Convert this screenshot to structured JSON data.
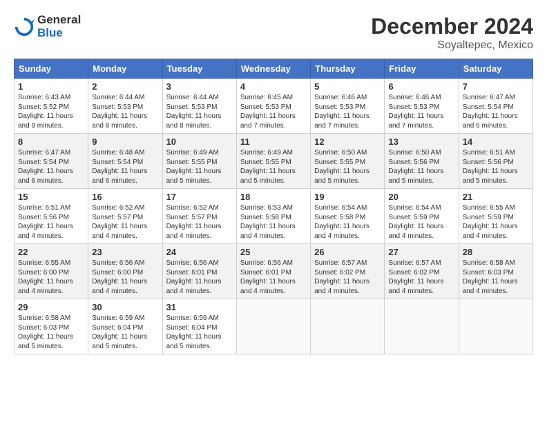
{
  "logo": {
    "general": "General",
    "blue": "Blue"
  },
  "title": {
    "month": "December 2024",
    "location": "Soyaltepec, Mexico"
  },
  "headers": [
    "Sunday",
    "Monday",
    "Tuesday",
    "Wednesday",
    "Thursday",
    "Friday",
    "Saturday"
  ],
  "weeks": [
    [
      {
        "day": "1",
        "sunrise": "6:43 AM",
        "sunset": "5:52 PM",
        "daylight": "11 hours and 9 minutes."
      },
      {
        "day": "2",
        "sunrise": "6:44 AM",
        "sunset": "5:53 PM",
        "daylight": "11 hours and 8 minutes."
      },
      {
        "day": "3",
        "sunrise": "6:44 AM",
        "sunset": "5:53 PM",
        "daylight": "11 hours and 8 minutes."
      },
      {
        "day": "4",
        "sunrise": "6:45 AM",
        "sunset": "5:53 PM",
        "daylight": "11 hours and 7 minutes."
      },
      {
        "day": "5",
        "sunrise": "6:46 AM",
        "sunset": "5:53 PM",
        "daylight": "11 hours and 7 minutes."
      },
      {
        "day": "6",
        "sunrise": "6:46 AM",
        "sunset": "5:53 PM",
        "daylight": "11 hours and 7 minutes."
      },
      {
        "day": "7",
        "sunrise": "6:47 AM",
        "sunset": "5:54 PM",
        "daylight": "11 hours and 6 minutes."
      }
    ],
    [
      {
        "day": "8",
        "sunrise": "6:47 AM",
        "sunset": "5:54 PM",
        "daylight": "11 hours and 6 minutes."
      },
      {
        "day": "9",
        "sunrise": "6:48 AM",
        "sunset": "5:54 PM",
        "daylight": "11 hours and 6 minutes."
      },
      {
        "day": "10",
        "sunrise": "6:49 AM",
        "sunset": "5:55 PM",
        "daylight": "11 hours and 5 minutes."
      },
      {
        "day": "11",
        "sunrise": "6:49 AM",
        "sunset": "5:55 PM",
        "daylight": "11 hours and 5 minutes."
      },
      {
        "day": "12",
        "sunrise": "6:50 AM",
        "sunset": "5:55 PM",
        "daylight": "11 hours and 5 minutes."
      },
      {
        "day": "13",
        "sunrise": "6:50 AM",
        "sunset": "5:56 PM",
        "daylight": "11 hours and 5 minutes."
      },
      {
        "day": "14",
        "sunrise": "6:51 AM",
        "sunset": "5:56 PM",
        "daylight": "11 hours and 5 minutes."
      }
    ],
    [
      {
        "day": "15",
        "sunrise": "6:51 AM",
        "sunset": "5:56 PM",
        "daylight": "11 hours and 4 minutes."
      },
      {
        "day": "16",
        "sunrise": "6:52 AM",
        "sunset": "5:57 PM",
        "daylight": "11 hours and 4 minutes."
      },
      {
        "day": "17",
        "sunrise": "6:52 AM",
        "sunset": "5:57 PM",
        "daylight": "11 hours and 4 minutes."
      },
      {
        "day": "18",
        "sunrise": "6:53 AM",
        "sunset": "5:58 PM",
        "daylight": "11 hours and 4 minutes."
      },
      {
        "day": "19",
        "sunrise": "6:54 AM",
        "sunset": "5:58 PM",
        "daylight": "11 hours and 4 minutes."
      },
      {
        "day": "20",
        "sunrise": "6:54 AM",
        "sunset": "5:59 PM",
        "daylight": "11 hours and 4 minutes."
      },
      {
        "day": "21",
        "sunrise": "6:55 AM",
        "sunset": "5:59 PM",
        "daylight": "11 hours and 4 minutes."
      }
    ],
    [
      {
        "day": "22",
        "sunrise": "6:55 AM",
        "sunset": "6:00 PM",
        "daylight": "11 hours and 4 minutes."
      },
      {
        "day": "23",
        "sunrise": "6:56 AM",
        "sunset": "6:00 PM",
        "daylight": "11 hours and 4 minutes."
      },
      {
        "day": "24",
        "sunrise": "6:56 AM",
        "sunset": "6:01 PM",
        "daylight": "11 hours and 4 minutes."
      },
      {
        "day": "25",
        "sunrise": "6:56 AM",
        "sunset": "6:01 PM",
        "daylight": "11 hours and 4 minutes."
      },
      {
        "day": "26",
        "sunrise": "6:57 AM",
        "sunset": "6:02 PM",
        "daylight": "11 hours and 4 minutes."
      },
      {
        "day": "27",
        "sunrise": "6:57 AM",
        "sunset": "6:02 PM",
        "daylight": "11 hours and 4 minutes."
      },
      {
        "day": "28",
        "sunrise": "6:58 AM",
        "sunset": "6:03 PM",
        "daylight": "11 hours and 4 minutes."
      }
    ],
    [
      {
        "day": "29",
        "sunrise": "6:58 AM",
        "sunset": "6:03 PM",
        "daylight": "11 hours and 5 minutes."
      },
      {
        "day": "30",
        "sunrise": "6:59 AM",
        "sunset": "6:04 PM",
        "daylight": "11 hours and 5 minutes."
      },
      {
        "day": "31",
        "sunrise": "6:59 AM",
        "sunset": "6:04 PM",
        "daylight": "11 hours and 5 minutes."
      },
      null,
      null,
      null,
      null
    ]
  ]
}
